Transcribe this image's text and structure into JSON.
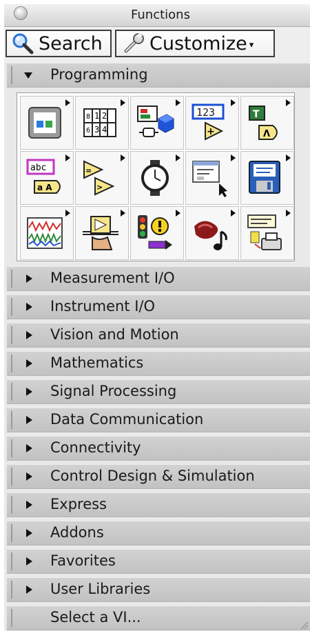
{
  "window": {
    "title": "Functions"
  },
  "toolbar": {
    "search_label": "Search",
    "customize_label": "Customize"
  },
  "expanded_category": {
    "label": "Programming",
    "icons": [
      "structures-icon",
      "array-icon",
      "cluster-class-variant-icon",
      "numeric-icon",
      "boolean-icon",
      "string-icon",
      "comparison-icon",
      "timing-icon",
      "dialog-user-interface-icon",
      "file-io-icon",
      "waveform-icon",
      "application-control-icon",
      "synchronization-icon",
      "graphics-sound-icon",
      "report-generation-icon"
    ]
  },
  "categories": [
    "Measurement I/O",
    "Instrument I/O",
    "Vision and Motion",
    "Mathematics",
    "Signal Processing",
    "Data Communication",
    "Connectivity",
    "Control Design & Simulation",
    "Express",
    "Addons",
    "Favorites",
    "User Libraries"
  ],
  "footer": {
    "select_vi_label": "Select a VI..."
  }
}
